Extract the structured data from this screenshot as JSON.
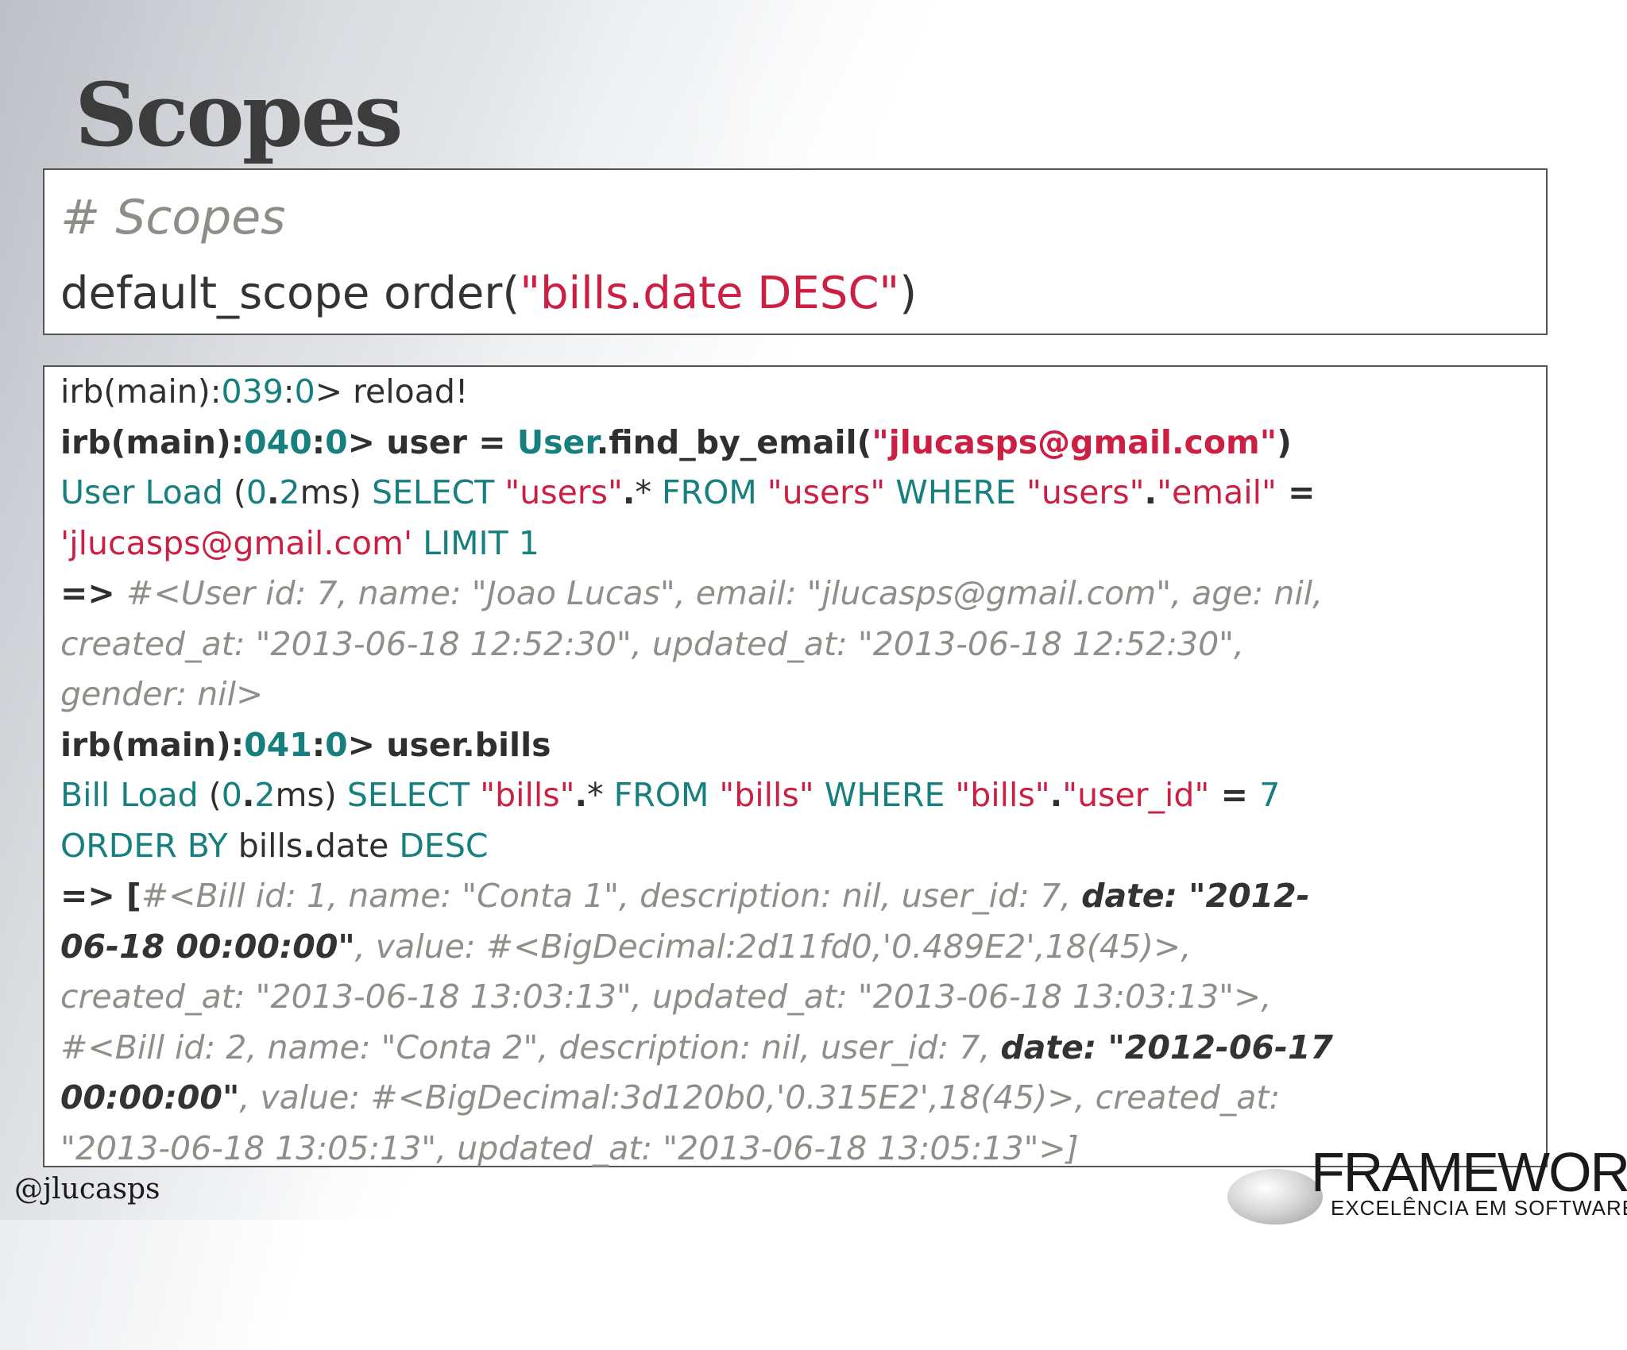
{
  "slide": {
    "title": "Scopes",
    "handle": "@jlucasps",
    "logo": {
      "word": "FRAMEWORK",
      "tagline": "EXCELÊNCIA EM SOFTWARE"
    }
  },
  "snippet": {
    "comment": "# Scopes",
    "code": {
      "prefix": "default_scope order(",
      "arg": "\"bills.date DESC\"",
      "suffix": ")"
    }
  },
  "console": {
    "l1": {
      "prompt": "irb(main):",
      "num": "039",
      "colon": ":",
      "zero": "0",
      "rest": "> reload!"
    },
    "l2": {
      "prompt": "irb(main):",
      "num": "040",
      "colon": ":",
      "zero": "0",
      "mid": "> user = ",
      "cls": "User",
      "call": ".find_by_email(",
      "str": "\"jlucasps@gmail.com\"",
      "close": ")"
    },
    "l3": {
      "a": " User Load",
      "b": " (",
      "c": "0",
      "d": ".",
      "e": "2",
      "f": "ms)  ",
      "g": "SELECT ",
      "h": "\"users\"",
      "i": ".",
      "j": "* ",
      "k": "FROM ",
      "l": "\"users\"",
      "m": " WHERE ",
      "n": "\"users\"",
      "o": ".",
      "p": "\"email\"",
      "q": " ="
    },
    "l4": {
      "a": "'jlucasps@gmail.com'",
      "b": " LIMIT 1"
    },
    "l5": {
      "arrow": "=> ",
      "text": "#<User id: 7, name: \"Joao Lucas\", email: \"jlucasps@gmail.com\", age: nil,"
    },
    "l6": {
      "text": "created_at: \"2013-06-18 12:52:30\", updated_at: \"2013-06-18 12:52:30\","
    },
    "l7": {
      "text": "gender: nil>"
    },
    "l8": {
      "prompt": "irb(main):",
      "num": "041",
      "colon": ":",
      "zero": "0",
      "rest": "> user.bills"
    },
    "l9": {
      "a": " Bill Load",
      "b": " (",
      "c": "0",
      "d": ".",
      "e": "2",
      "f": "ms)  ",
      "g": "SELECT ",
      "h": "\"bills\"",
      "i": ".",
      "j": "* ",
      "k": "FROM ",
      "l": "\"bills\"",
      "m": " WHERE ",
      "n": "\"bills\"",
      "o": ".",
      "p": "\"user_id\"",
      "q": " = ",
      "r": "7"
    },
    "l10": {
      "a": "ORDER BY ",
      "b": "bills",
      "c": ".",
      "d": "date ",
      "e": "DESC"
    },
    "l11": {
      "arrow": "=> [",
      "text": "#<Bill id: 1, name: \"Conta 1\", description: nil, user_id: 7, ",
      "bold": "date: \"2012-"
    },
    "l12": {
      "bold": "06-18 00:00:00\"",
      "text": ", value: #<BigDecimal:2d11fd0,'0.489E2',18(45)>,"
    },
    "l13": {
      "text": "created_at: \"2013-06-18 13:03:13\", updated_at: \"2013-06-18 13:03:13\">,"
    },
    "l14": {
      "text": "#<Bill id: 2, name: \"Conta 2\", description: nil, user_id: 7, ",
      "bold": "date: \"2012-06-17"
    },
    "l15": {
      "bold": "00:00:00\"",
      "text": ", value: #<BigDecimal:3d120b0,'0.315E2',18(45)>, created_at:"
    },
    "l16": {
      "text": "\"2013-06-18 13:05:13\", updated_at: \"2013-06-18 13:05:13\">]"
    }
  }
}
